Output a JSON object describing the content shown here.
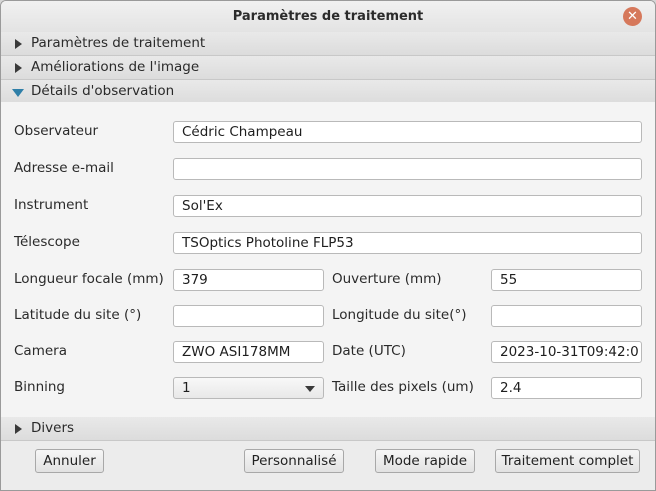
{
  "window": {
    "title": "Paramètres de traitement",
    "close_glyph": "✕"
  },
  "sections": [
    {
      "label": "Paramètres de traitement",
      "expanded": false
    },
    {
      "label": "Améliorations de l'image",
      "expanded": false
    },
    {
      "label": "Détails d'observation",
      "expanded": true
    },
    {
      "label": "Divers",
      "expanded": false
    }
  ],
  "form": {
    "observer": {
      "label": "Observateur",
      "value": "Cédric Champeau"
    },
    "email": {
      "label": "Adresse e-mail",
      "value": ""
    },
    "instrument": {
      "label": "Instrument",
      "value": "Sol'Ex"
    },
    "telescope": {
      "label": "Télescope",
      "value": "TSOptics Photoline FLP53"
    },
    "focal_length": {
      "label": "Longueur focale (mm)",
      "value": "379"
    },
    "aperture": {
      "label": "Ouverture (mm)",
      "value": "55"
    },
    "latitude": {
      "label": "Latitude du site (°)",
      "value": ""
    },
    "longitude": {
      "label": "Longitude du site(°)",
      "value": ""
    },
    "camera": {
      "label": "Camera",
      "value": "ZWO ASI178MM"
    },
    "date": {
      "label": "Date (UTC)",
      "value": "2023-10-31T09:42:0"
    },
    "binning": {
      "label": "Binning",
      "value": "1"
    },
    "pixel_size": {
      "label": "Taille des pixels (um)",
      "value": "2.4"
    }
  },
  "footer": {
    "cancel_label": "Annuler",
    "custom_label": "Personnalisé",
    "quick_label": "Mode rapide",
    "full_label": "Traitement complet"
  },
  "icons": {
    "close": "close-icon",
    "collapsed": "triangle-right-icon",
    "expanded": "triangle-down-icon",
    "dropdown": "chevron-down-icon"
  },
  "colors": {
    "expanded_arrow": "#2f7fa8",
    "close_button": "#d6785b"
  }
}
